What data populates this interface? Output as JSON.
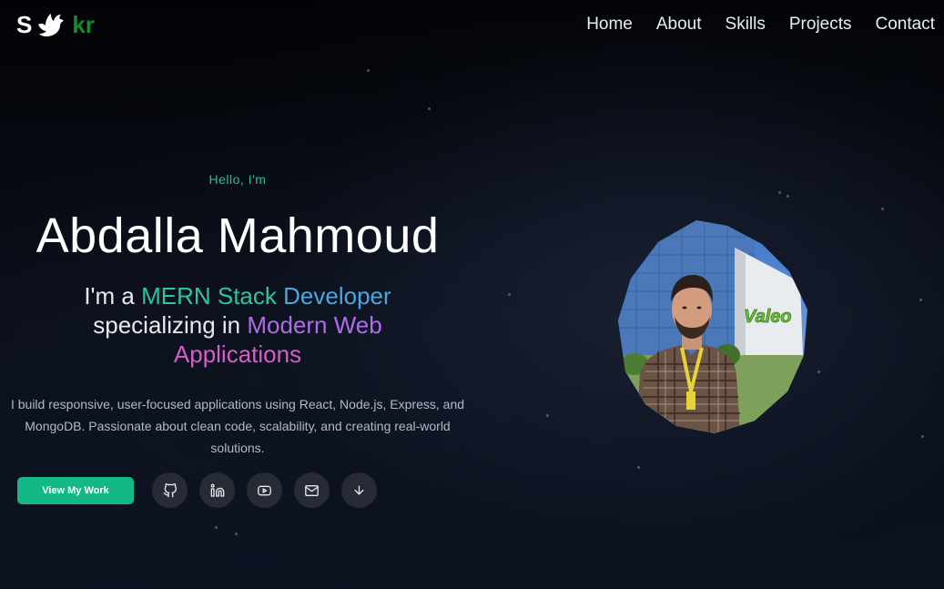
{
  "logo": {
    "letter": "S",
    "suffix": "kr",
    "icon": "bird-icon"
  },
  "nav": {
    "items": [
      {
        "label": "Home"
      },
      {
        "label": "About"
      },
      {
        "label": "Skills"
      },
      {
        "label": "Projects"
      },
      {
        "label": "Contact"
      }
    ]
  },
  "hero": {
    "greeting": "Hello, I'm",
    "name": "Abdalla Mahmoud",
    "tagline": {
      "prefix": "I'm a ",
      "highlight_1": "MERN Stack",
      "highlight_2": "Developer",
      "middle": "specializing in ",
      "highlight_3": "Modern Web",
      "highlight_4": "Applications"
    },
    "description": "I build responsive, user-focused applications using React, Node.js, Express, and MongoDB. Passionate about clean code, scalability, and creating real-world solutions.",
    "cta_label": "View My Work",
    "social_icons": [
      "github-icon",
      "linkedin-icon",
      "youtube-icon",
      "mail-icon",
      "arrow-down-icon"
    ]
  },
  "photo": {
    "sign_text": "Valeo"
  },
  "colors": {
    "accent": "#12b886",
    "greeting": "#22c58a",
    "logo_suffix": "#1a8a2e",
    "icon_bg": "#262b35"
  }
}
